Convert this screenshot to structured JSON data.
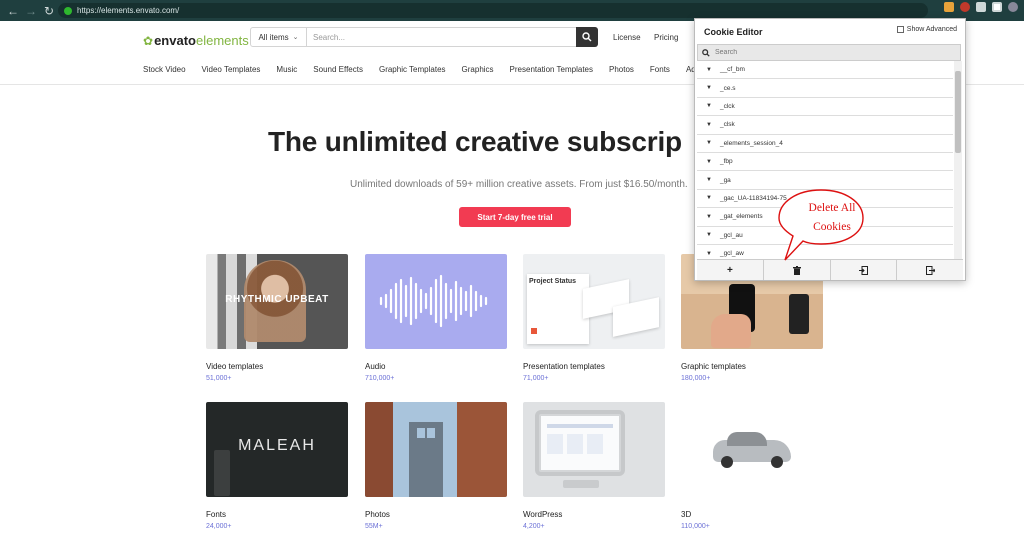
{
  "browser": {
    "url": "https://elements.envato.com/"
  },
  "header": {
    "logo_envato": "envato",
    "logo_elements": "elements",
    "search_category": "All items",
    "search_placeholder": "Search...",
    "license": "License",
    "pricing": "Pricing"
  },
  "categories": [
    "Stock Video",
    "Video Templates",
    "Music",
    "Sound Effects",
    "Graphic Templates",
    "Graphics",
    "Presentation Templates",
    "Photos",
    "Fonts",
    "Add-o"
  ],
  "hero": {
    "title": "The unlimited creative subscrip",
    "subtitle": "Unlimited downloads of 59+ million creative assets. From just $16.50/month.",
    "cta": "Start 7-day free trial"
  },
  "cards": [
    {
      "title": "Video templates",
      "count": "51,000+",
      "overlay": "RHYTHMIC UPBEAT"
    },
    {
      "title": "Audio",
      "count": "710,000+"
    },
    {
      "title": "Presentation templates",
      "count": "71,000+",
      "overlay": "Project Status"
    },
    {
      "title": "Graphic templates",
      "count": "180,000+"
    },
    {
      "title": "Fonts",
      "count": "24,000+",
      "overlay": "MALEAH"
    },
    {
      "title": "Photos",
      "count": "55M+"
    },
    {
      "title": "WordPress",
      "count": "4,200+"
    },
    {
      "title": "3D",
      "count": "110,000+"
    }
  ],
  "cookie_editor": {
    "title": "Cookie Editor",
    "show_advanced": "Show Advanced",
    "search_placeholder": "Search",
    "cookies": [
      "__cf_bm",
      "_ce.s",
      "_clck",
      "_clsk",
      "_elements_session_4",
      "_fbp",
      "_ga",
      "_gac_UA-11834194-75",
      "_gat_elements",
      "_gcl_au",
      "_gcl_aw"
    ],
    "toolbar": [
      "add-icon",
      "trash-icon",
      "import-icon",
      "export-icon"
    ]
  },
  "callout": {
    "line1": "Delete All",
    "line2": "Cookies",
    "color": "#dd1111"
  },
  "colors": {
    "accent": "#f23b52",
    "brand_green": "#82b541",
    "count": "#6b70d6"
  }
}
